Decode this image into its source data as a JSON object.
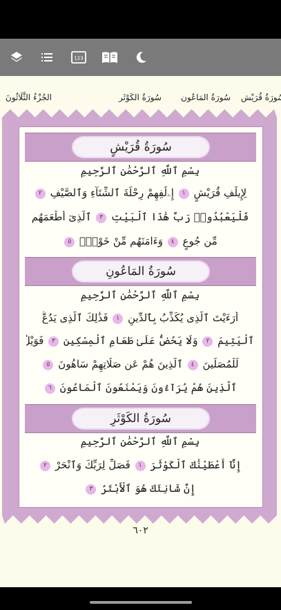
{
  "toolbar": {
    "icons": [
      "layers-icon",
      "list-icon",
      "page-number-icon",
      "book-icon",
      "moon-icon"
    ],
    "page_number_label": "123"
  },
  "header": {
    "juz": "الجُزْءُ الثَّلَاثُونَ",
    "sura_kawthar": "سُورَةُ الكَوْثَر",
    "sura_maun": "سُورَةُ المَاعُون",
    "sura_quraysh": "سُورَةُ قُرَيْش"
  },
  "suras": [
    {
      "title": "سُورَةُ قُرَيْشٍ",
      "basmala": "بِسْمِ ٱللَّهِ ٱلرَّحْمَٰنِ ٱلرَّحِيمِ",
      "lines": [
        {
          "text": "لِإِيلَٰفِ قُرَيْشٍ",
          "ayah": "١",
          "text2": "إِۦلَٰفِهِمْ رِحْلَةَ ٱلشِّتَآءِ وَٱلصَّيْفِ",
          "ayah2": "٢"
        },
        {
          "text": "فَلْيَعْبُدُوا۟ رَبَّ هَٰذَا ٱلْبَيْتِ",
          "ayah": "٣",
          "text2": "ٱلَّذِىٓ أَطْعَمَهُم",
          "ayah2": ""
        },
        {
          "text": "مِّن جُوعٍ",
          "ayah": "٤",
          "text2": "وَءَامَنَهُم مِّنْ خَوْفٍۭ",
          "ayah2": "٥"
        }
      ]
    },
    {
      "title": "سُورَةُ المَاعُونِ",
      "basmala": "بِسْمِ ٱللَّهِ ٱلرَّحْمَٰنِ ٱلرَّحِيمِ",
      "lines": [
        {
          "text": "أَرَءَيْتَ ٱلَّذِى يُكَذِّبُ بِٱلدِّينِ",
          "ayah": "١",
          "text2": "فَذَٰلِكَ ٱلَّذِى يَدُعُّ",
          "ayah2": ""
        },
        {
          "text": "ٱلْيَتِيمَ",
          "ayah": "٢",
          "text2": "وَلَا يَحُضُّ عَلَىٰ طَعَامِ ٱلْمِسْكِينِ",
          "ayah2": "٣",
          "text3": "فَوَيْلٌ"
        },
        {
          "text": "لِّلْمُصَلِّينَ",
          "ayah": "٤",
          "text2": "ٱلَّذِينَ هُمْ عَن صَلَاتِهِمْ سَاهُونَ",
          "ayah2": "٥"
        },
        {
          "text": "ٱلَّذِينَ هُمْ يُرَآءُونَ وَيَمْنَعُونَ ٱلْمَاعُونَ",
          "ayah": "٦",
          "text2": "",
          "ayah2": ""
        }
      ]
    },
    {
      "title": "سُورَةُ الكَوْثَرِ",
      "basmala": "بِسْمِ ٱللَّهِ ٱلرَّحْمَٰنِ ٱلرَّحِيمِ",
      "lines": [
        {
          "text": "إِنَّآ أَعْطَيْنَٰكَ ٱلْكَوْثَرَ",
          "ayah": "١",
          "text2": "فَصَلِّ لِرَبِّكَ وَٱنْحَرْ",
          "ayah2": "٢"
        },
        {
          "text": "إِنَّ شَانِئَكَ هُوَ ٱلْأَبْتَرُ",
          "ayah": "٣",
          "text2": "",
          "ayah2": ""
        }
      ]
    }
  ],
  "page_number": "٦٠٢"
}
